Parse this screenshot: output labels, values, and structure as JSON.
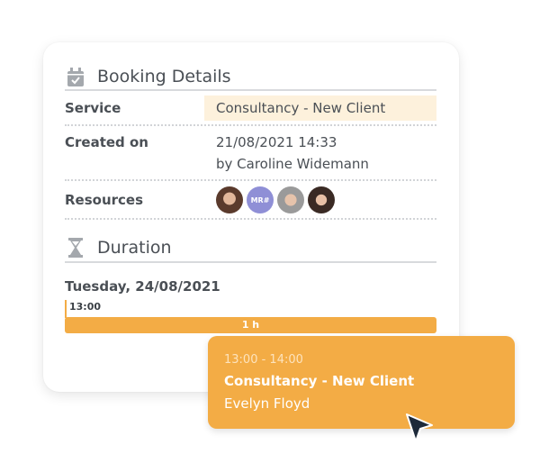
{
  "booking": {
    "title": "Booking Details",
    "title_icon": "calendar-check-icon",
    "service_label": "Service",
    "service_value": "Consultancy - New Client",
    "created_label": "Created on",
    "created_date": "21/08/2021 14:33",
    "created_by": "by Caroline Widemann",
    "resources_label": "Resources",
    "resources": [
      {
        "type": "photo"
      },
      {
        "type": "initials",
        "initials": "MR#",
        "color": "#8f8fd6"
      },
      {
        "type": "photo"
      },
      {
        "type": "photo"
      }
    ]
  },
  "duration": {
    "title": "Duration",
    "title_icon": "hourglass-icon",
    "date": "Tuesday, 24/08/2021",
    "start_time": "13:00",
    "bar_label": "1 h"
  },
  "tooltip": {
    "time_range": "13:00 - 14:00",
    "service": "Consultancy - New Client",
    "customer": "Evelyn Floyd"
  },
  "colors": {
    "accent": "#f3ac45",
    "highlight": "#fdf1dc",
    "cursor": "#1d2a3a"
  }
}
